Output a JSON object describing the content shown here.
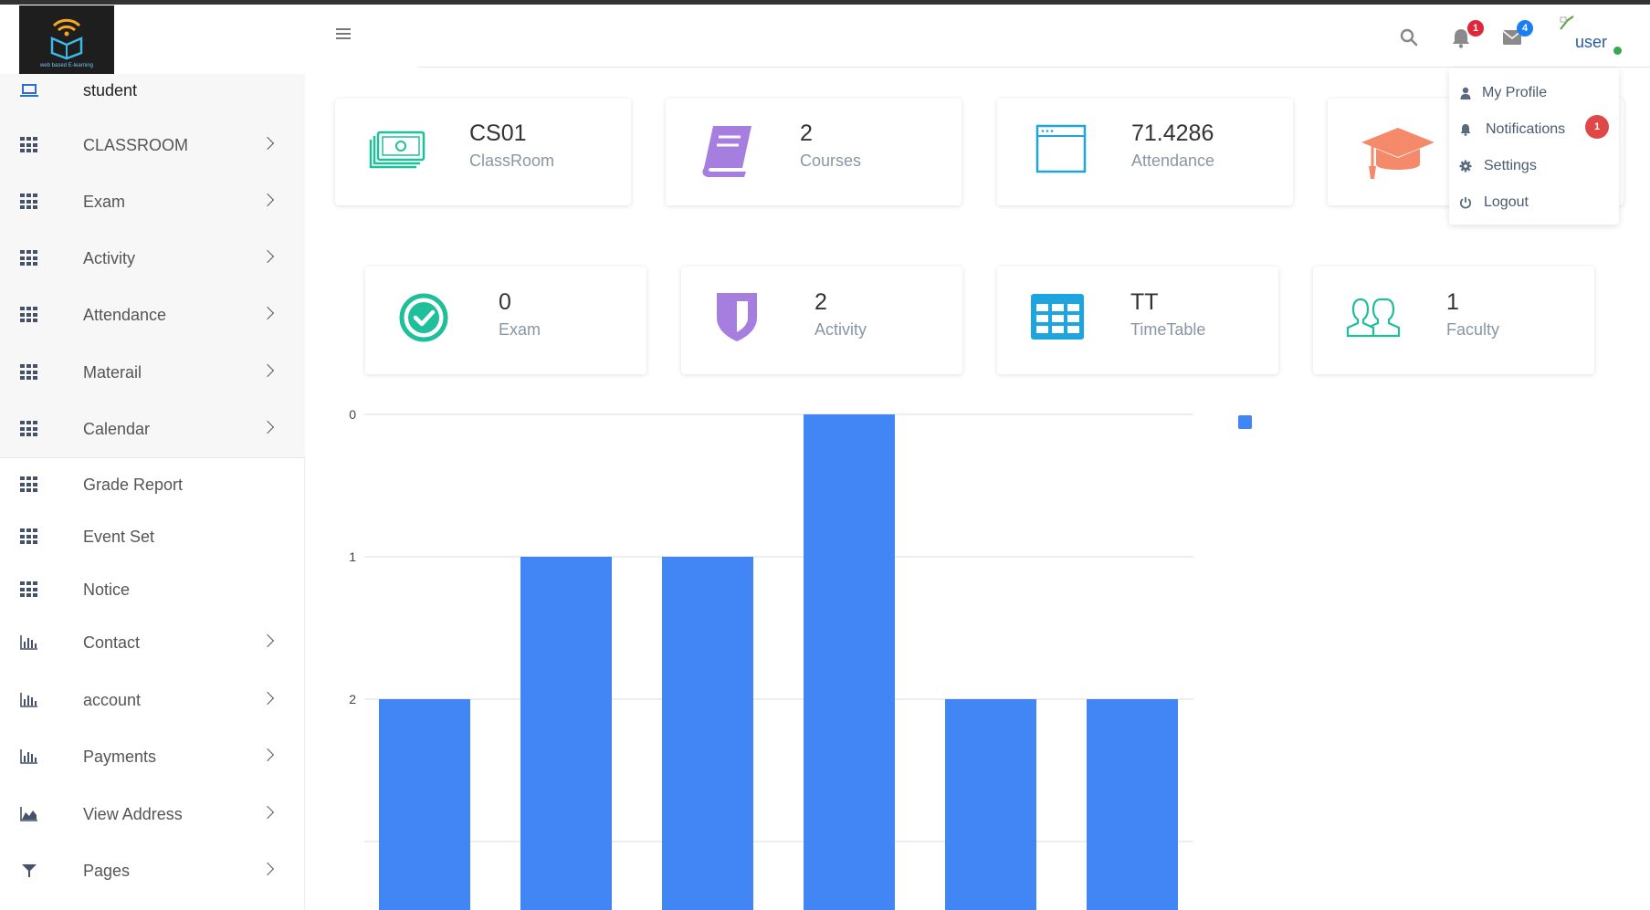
{
  "header": {
    "logo_text": "web based E-learning",
    "user_label": "user",
    "notifications_badge": "1",
    "messages_badge": "4",
    "colors": {
      "notif_badge": "#e0263a",
      "msg_badge": "#1a7ff0",
      "online": "#3aa74a"
    }
  },
  "sidebar": {
    "items": [
      {
        "label": "student",
        "icon": "laptop-icon",
        "has_arrow": false
      },
      {
        "label": "CLASSROOM",
        "icon": "grid-icon",
        "has_arrow": true
      },
      {
        "label": "Exam",
        "icon": "grid-icon",
        "has_arrow": true
      },
      {
        "label": "Activity",
        "icon": "grid-icon",
        "has_arrow": true
      },
      {
        "label": "Attendance",
        "icon": "grid-icon",
        "has_arrow": true
      },
      {
        "label": "Materail",
        "icon": "grid-icon",
        "has_arrow": true
      },
      {
        "label": "Calendar",
        "icon": "grid-icon",
        "has_arrow": true
      },
      {
        "label": "Grade Report",
        "icon": "grid-icon",
        "has_arrow": false
      },
      {
        "label": "Event Set",
        "icon": "grid-icon",
        "has_arrow": false
      },
      {
        "label": "Notice",
        "icon": "grid-icon",
        "has_arrow": false
      },
      {
        "label": "Contact",
        "icon": "bar-chart-icon",
        "has_arrow": true
      },
      {
        "label": "account",
        "icon": "bar-chart-icon",
        "has_arrow": true
      },
      {
        "label": "Payments",
        "icon": "bar-chart-icon",
        "has_arrow": true
      },
      {
        "label": "View Address",
        "icon": "area-chart-icon",
        "has_arrow": true
      },
      {
        "label": "Pages",
        "icon": "filter-icon",
        "has_arrow": true
      }
    ]
  },
  "cards_row1": [
    {
      "value": "CS01",
      "label": "ClassRoom",
      "icon": "money-icon",
      "color": "#1fbf9c"
    },
    {
      "value": "2",
      "label": "Courses",
      "icon": "book-icon",
      "color": "#a57ee0"
    },
    {
      "value": "71.4286",
      "label": "Attendance",
      "icon": "window-icon",
      "color": "#1ea5e0"
    },
    {
      "value": "",
      "label": "",
      "icon": "graduation-cap-icon",
      "color": "#f48a6a"
    }
  ],
  "cards_row2": [
    {
      "value": "0",
      "label": "Exam",
      "icon": "check-circle-icon",
      "color": "#1fbf9c"
    },
    {
      "value": "2",
      "label": "Activity",
      "icon": "shield-icon",
      "color": "#a57ee0"
    },
    {
      "value": "TT",
      "label": "TimeTable",
      "icon": "table-icon",
      "color": "#1ea5e0"
    },
    {
      "value": "1",
      "label": "Faculty",
      "icon": "users-icon",
      "color": "#1fbf9c"
    }
  ],
  "dropdown": {
    "items": [
      {
        "label": "My Profile",
        "icon": "user-icon"
      },
      {
        "label": "Notifications",
        "icon": "bell-icon"
      },
      {
        "label": "Settings",
        "icon": "gear-icon"
      },
      {
        "label": "Logout",
        "icon": "power-icon"
      }
    ],
    "notifications_count": "1"
  },
  "chart_data": {
    "type": "bar",
    "categories": [
      "",
      "",
      "",
      "",
      "",
      ""
    ],
    "series": [
      {
        "values": [
          2,
          1,
          1,
          0,
          2,
          2
        ],
        "color": "#4285f4"
      }
    ],
    "y_ticks": [
      "0",
      "1",
      "2"
    ],
    "y_axis_reversed": true,
    "ylim": [
      0,
      3
    ],
    "grid": true,
    "legend": "top-right"
  }
}
